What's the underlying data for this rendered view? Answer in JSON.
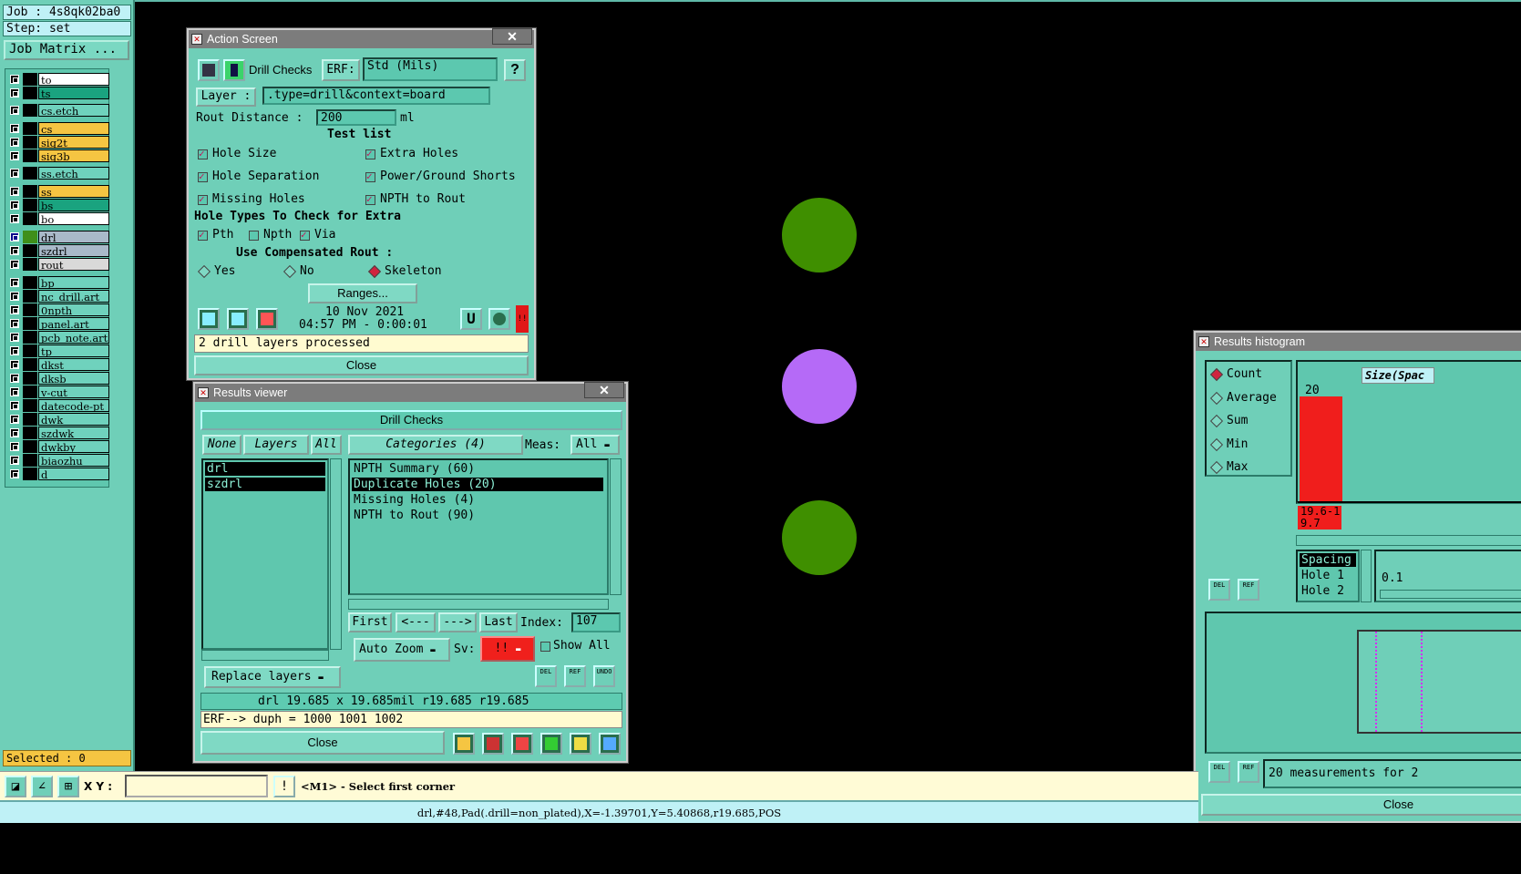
{
  "left_panel": {
    "job": "Job : 4s8qk02ba0",
    "step": "Step: set",
    "job_matrix": "Job Matrix ...",
    "layers": [
      {
        "name": "to",
        "color": "#ffffff",
        "swatch": "#000000"
      },
      {
        "name": "ts",
        "color": "#1aa37f",
        "swatch": "#000000"
      },
      {
        "name": "cs.etch",
        "color": "#6fd2bd",
        "swatch": "#000000"
      },
      {
        "name": "cs",
        "color": "#f5c542",
        "swatch": "#000000"
      },
      {
        "name": "sig2t",
        "color": "#f5c542",
        "swatch": "#000000"
      },
      {
        "name": "sig3b",
        "color": "#f5c542",
        "swatch": "#000000"
      },
      {
        "name": "ss.etch",
        "color": "#6fd2bd",
        "swatch": "#000000"
      },
      {
        "name": "ss",
        "color": "#f5c542",
        "swatch": "#000000"
      },
      {
        "name": "bs",
        "color": "#1aa37f",
        "swatch": "#000000"
      },
      {
        "name": "bo",
        "color": "#ffffff",
        "swatch": "#000000"
      },
      {
        "name": "drl",
        "color": "#a9b9c9",
        "swatch": "#3f8f1a"
      },
      {
        "name": "szdrl",
        "color": "#a9b9c9",
        "swatch": "#000000"
      },
      {
        "name": "rout",
        "color": "#d9d9d9",
        "swatch": "#000000"
      },
      {
        "name": "bp",
        "color": "#6fd2bd",
        "swatch": "#000000"
      },
      {
        "name": "nc_drill.art",
        "color": "#6fd2bd",
        "swatch": "#000000"
      },
      {
        "name": "0npth",
        "color": "#6fd2bd",
        "swatch": "#000000"
      },
      {
        "name": "panel.art",
        "color": "#6fd2bd",
        "swatch": "#000000"
      },
      {
        "name": "pcb_note.art",
        "color": "#6fd2bd",
        "swatch": "#000000"
      },
      {
        "name": "tp",
        "color": "#6fd2bd",
        "swatch": "#000000"
      },
      {
        "name": "dkst",
        "color": "#6fd2bd",
        "swatch": "#000000"
      },
      {
        "name": "dksb",
        "color": "#6fd2bd",
        "swatch": "#000000"
      },
      {
        "name": "v-cut",
        "color": "#6fd2bd",
        "swatch": "#000000"
      },
      {
        "name": "datecode-pt",
        "color": "#6fd2bd",
        "swatch": "#000000"
      },
      {
        "name": "dwk",
        "color": "#6fd2bd",
        "swatch": "#000000"
      },
      {
        "name": "szdwk",
        "color": "#6fd2bd",
        "swatch": "#000000"
      },
      {
        "name": "dwkby",
        "color": "#6fd2bd",
        "swatch": "#000000"
      },
      {
        "name": "biaozhu",
        "color": "#6fd2bd",
        "swatch": "#000000"
      },
      {
        "name": "d",
        "color": "#6fd2bd",
        "swatch": "#000000"
      }
    ],
    "selected": "Selected : 0"
  },
  "canvas": {
    "pads": [
      {
        "color": "#3f8f00"
      },
      {
        "color": "#b56af7"
      },
      {
        "color": "#3f8f00"
      }
    ]
  },
  "action_screen": {
    "title": "Action Screen",
    "close_x": "✕",
    "heading": "Drill Checks",
    "erf_label": "ERF:",
    "erf_value": "Std (Mils)",
    "help": "?",
    "layer_label": "Layer :",
    "layer_value": ".type=drill&context=board",
    "rout_distance_label": "Rout Distance :",
    "rout_distance_value": "200",
    "rout_distance_unit": "ml",
    "test_list_label": "Test list",
    "tests": [
      {
        "label": "Hole Size",
        "checked": true
      },
      {
        "label": "Extra Holes",
        "checked": true
      },
      {
        "label": "Hole Separation",
        "checked": true
      },
      {
        "label": "Power/Ground Shorts",
        "checked": true
      },
      {
        "label": "Missing Holes",
        "checked": true
      },
      {
        "label": "NPTH to Rout",
        "checked": true
      }
    ],
    "hole_types_label": "Hole Types To Check for Extra",
    "hole_types": [
      {
        "label": "Pth",
        "checked": true
      },
      {
        "label": "Npth",
        "checked": false
      },
      {
        "label": "Via",
        "checked": true
      }
    ],
    "comp_rout_label": "Use Compensated Rout :",
    "comp_rout_options": [
      {
        "label": "Yes",
        "selected": false
      },
      {
        "label": "No",
        "selected": false
      },
      {
        "label": "Skeleton",
        "selected": true
      }
    ],
    "ranges_button": "Ranges...",
    "date": "10 Nov 2021",
    "time": "04:57 PM - 0:00:01",
    "alert": "!!",
    "status": "2 drill layers processed",
    "close_button": "Close"
  },
  "results_viewer": {
    "title": "Results viewer",
    "close_x": "✕",
    "heading": "Drill Checks",
    "none_btn": "None",
    "layers_btn": "Layers",
    "all_btn": "All",
    "categories_btn": "Categories (4)",
    "meas_label": "Meas:",
    "meas_value": "All",
    "layers": [
      "drl",
      "szdrl"
    ],
    "categories": [
      {
        "label": "NPTH Summary (60)",
        "selected": false
      },
      {
        "label": "Duplicate Holes (20)",
        "selected": true
      },
      {
        "label": "Missing Holes (4)",
        "selected": false
      },
      {
        "label": "NPTH to Rout (90)",
        "selected": false
      }
    ],
    "first_btn": "First",
    "prev_btn": "<---",
    "next_btn": "--->",
    "last_btn": "Last",
    "index_label": "Index:",
    "index_value": "107",
    "auto_zoom": "Auto Zoom",
    "sv_label": "Sv:",
    "sv_value": "!!",
    "show_all": "Show All",
    "replace_layers": "Replace layers",
    "del": "DEL",
    "ref": "REF",
    "undo": "UNDO",
    "info_line": "drl  19.685 x 19.685mil  r19.685  r19.685",
    "erf_line": "ERF--> duph = 1000 1001 1002",
    "close_button": "Close"
  },
  "histogram": {
    "title": "Results histogram",
    "modes": [
      {
        "label": "Count",
        "selected": true
      },
      {
        "label": "Average",
        "selected": false
      },
      {
        "label": "Sum",
        "selected": false
      },
      {
        "label": "Min",
        "selected": false
      },
      {
        "label": "Max",
        "selected": false
      }
    ],
    "size_label": "Size(Spac",
    "bar_value": "20",
    "bar_range": "19.6-19.7",
    "spacing_items": [
      "Spacing",
      "Hole 1",
      "Hole 2"
    ],
    "scale_value": "0.1",
    "del": "DEL",
    "ref": "REF",
    "measurements": "20 measurements for 2",
    "close_button": "Close"
  },
  "command_bar": {
    "xy_label": "X Y :",
    "xy_value": "",
    "prompt": "<M1> - Select first corner"
  },
  "status_bar": {
    "text": "drl,#48,Pad(.drill=non_plated),X=-1.39701,Y=5.40868,r19.685,POS"
  }
}
